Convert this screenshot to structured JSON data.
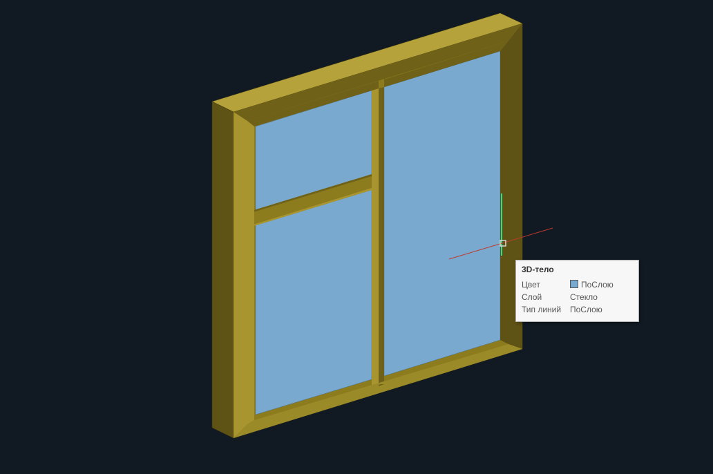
{
  "tooltip": {
    "title": "3D-тело",
    "rows": [
      {
        "label": "Цвет",
        "value": "ПоСлою",
        "hasSwatch": true
      },
      {
        "label": "Слой",
        "value": "Стекло",
        "hasSwatch": false
      },
      {
        "label": "Тип линий",
        "value": "ПоСлою",
        "hasSwatch": false
      }
    ]
  },
  "object": {
    "type": "window",
    "frame_color": "#8c7c1e",
    "glass_color": "#79a9ce"
  },
  "colors": {
    "background": "#111a23",
    "frame_light": "#b5a23a",
    "frame_mid": "#8c7c1e",
    "frame_dark": "#5e5215",
    "glass": "#79a9ce",
    "highlight": "#2fe08a"
  }
}
